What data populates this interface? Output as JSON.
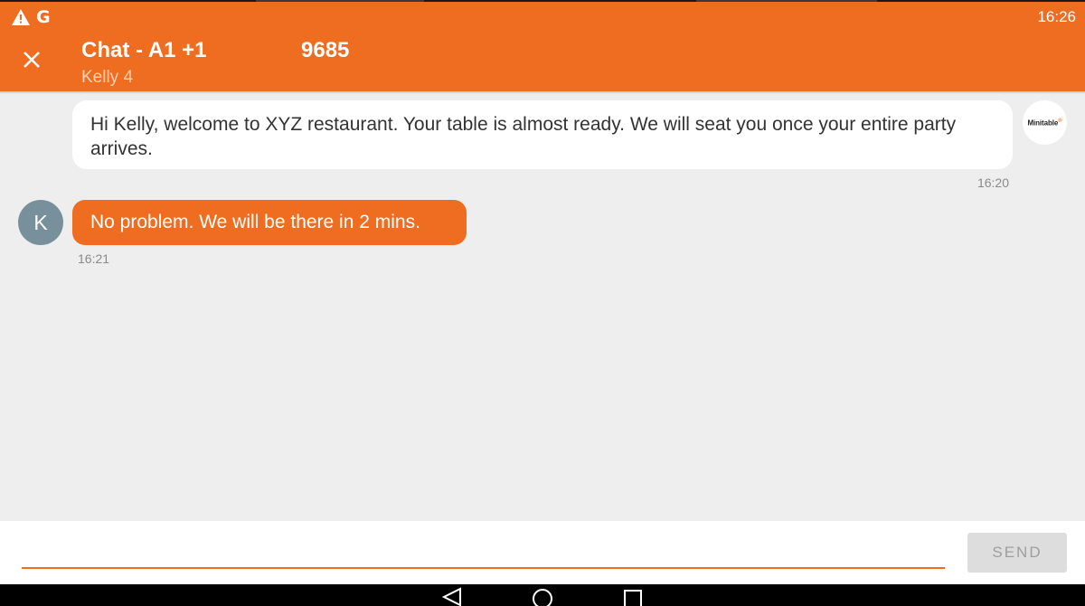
{
  "status_bar": {
    "time": "16:26",
    "icons": [
      "warning-icon",
      "google-g-icon"
    ],
    "g_glyph": "G"
  },
  "header": {
    "title": "Chat - A1 +1",
    "number": "9685",
    "subtitle": "Kelly 4",
    "close_icon": "close-icon",
    "background_color": "#ef6d21"
  },
  "messages": [
    {
      "direction": "incoming",
      "text": "Hi Kelly, welcome to XYZ restaurant. Your table is almost ready. We will seat you once your entire party arrives.",
      "time": "16:20",
      "avatar_label": "Minitable",
      "avatar_mark": "®"
    },
    {
      "direction": "outgoing",
      "text": "No problem. We will be there in 2 mins.",
      "time": "16:21",
      "avatar_initial": "K",
      "avatar_color": "#78909c"
    }
  ],
  "composer": {
    "placeholder": "",
    "value": "",
    "send_label": "SEND"
  },
  "nav_bar": {
    "buttons": [
      "back-icon",
      "home-icon",
      "recents-icon"
    ]
  },
  "colors": {
    "accent": "#ef6d21",
    "background": "#eeeeee",
    "timestamp": "#8a8a8a"
  }
}
